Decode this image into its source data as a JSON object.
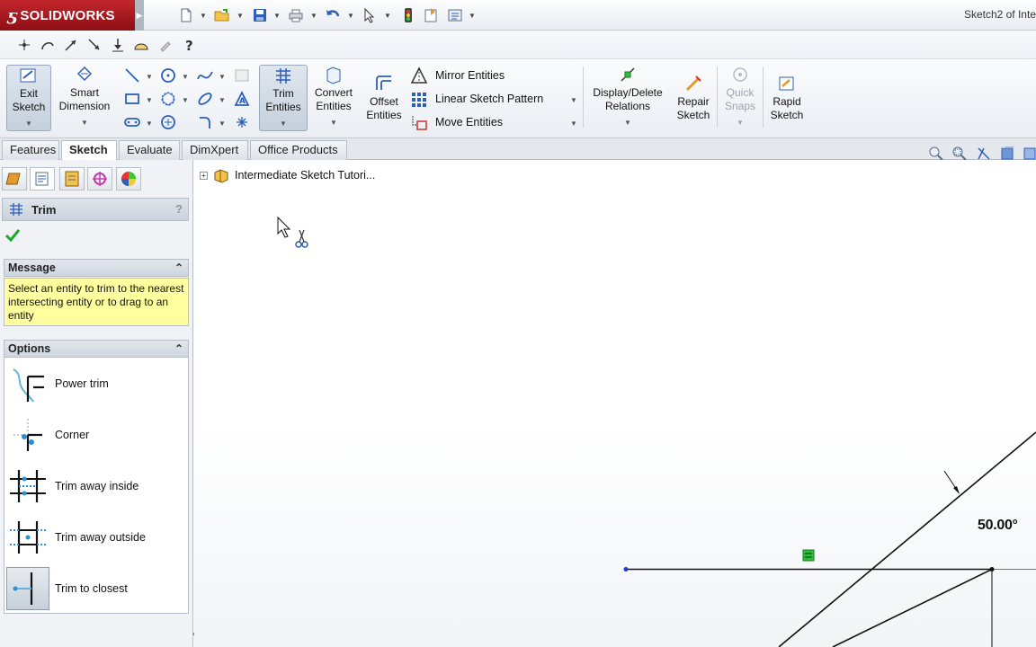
{
  "app": {
    "name": "SOLIDWORKS",
    "doc_title": "Sketch2 of Inte"
  },
  "command_manager": {
    "exit_sketch": "Exit Sketch",
    "smart_dimension": "Smart Dimension",
    "trim_entities": "Trim Entities",
    "convert_entities": "Convert Entities",
    "offset_entities": "Offset Entities",
    "mirror_entities": "Mirror Entities",
    "linear_sketch_pattern": "Linear Sketch Pattern",
    "move_entities": "Move Entities",
    "display_delete_relations": "Display/Delete Relations",
    "repair_sketch": "Repair Sketch",
    "quick_snaps": "Quick Snaps",
    "rapid_sketch": "Rapid Sketch"
  },
  "tabs": [
    {
      "label": "Features"
    },
    {
      "label": "Sketch"
    },
    {
      "label": "Evaluate"
    },
    {
      "label": "DimXpert"
    },
    {
      "label": "Office Products"
    }
  ],
  "property_manager": {
    "title": "Trim",
    "help": "?",
    "message_header": "Message",
    "message_text": "Select an entity to trim to the nearest intersecting entity or to drag to an entity",
    "options_header": "Options",
    "options": [
      {
        "label": "Power trim"
      },
      {
        "label": "Corner"
      },
      {
        "label": "Trim away inside"
      },
      {
        "label": "Trim away outside"
      },
      {
        "label": "Trim to closest"
      }
    ],
    "selected_option": "Trim to closest"
  },
  "canvas": {
    "tree_item": "Intermediate Sketch Tutori...",
    "angle_dimension": "50.00°"
  },
  "colors": {
    "brand_red": "#c3262c",
    "message_bg": "#ffff9f",
    "sketch_line": "#111111",
    "relation_green": "#2fbf3a",
    "endpoint_blue": "#1a3cc8"
  }
}
